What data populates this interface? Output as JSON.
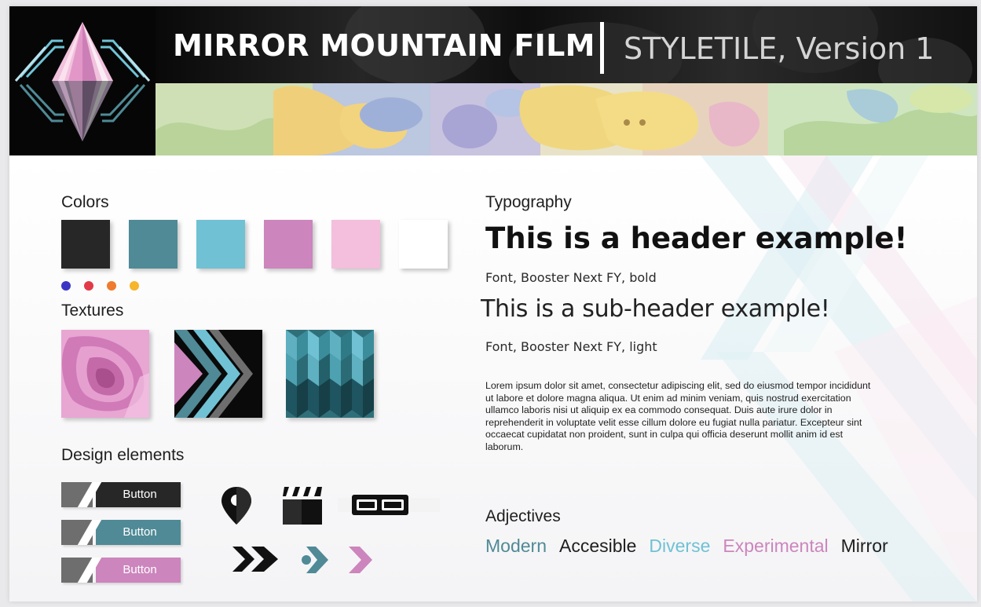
{
  "header": {
    "brand": "MIRROR MOUNTAIN FILM",
    "version": "STYLETILE, Version 1",
    "logo_icon": "mirror-mountain-logo-icon"
  },
  "colors": {
    "label": "Colors",
    "swatches": [
      "#272727",
      "#4f8a96",
      "#70c1d4",
      "#cc85bd",
      "#f3bfdc",
      "#ffffff"
    ],
    "dots": [
      "#3b37c4",
      "#e23a48",
      "#f07a2e",
      "#f6b52a"
    ]
  },
  "textures": {
    "label": "Textures",
    "items": [
      "pink-contour-texture",
      "black-chevron-texture",
      "teal-geometric-texture"
    ]
  },
  "design_elements": {
    "label": "Design elements",
    "buttons": [
      {
        "label": "Button",
        "bg": "#272727",
        "color": "#ffffff"
      },
      {
        "label": "Button",
        "bg": "#4f8a96",
        "color": "#ffffff"
      },
      {
        "label": "Button",
        "bg": "#cc85bd",
        "color": "#ffffff"
      }
    ],
    "icons": [
      "location-pin-icon",
      "clapperboard-icon",
      "film-strip-icon",
      "double-chevron-icon",
      "teal-chevron-icon",
      "pink-chevron-icon"
    ]
  },
  "typography": {
    "label": "Typography",
    "header_example": "This is a header example!",
    "header_font": "Font, Booster Next FY, bold",
    "subheader_example": "This is a sub-header example!",
    "subheader_font": "Font, Booster Next FY, light",
    "body_text": "Lorem ipsum dolor sit amet, consectetur adipiscing elit, sed do eiusmod tempor incididunt ut labore et dolore magna aliqua. Ut enim ad minim veniam, quis nostrud exercitation ullamco laboris nisi ut aliquip ex ea commodo consequat. Duis aute irure dolor in reprehenderit in voluptate velit esse cillum dolore eu fugiat nulla pariatur. Excepteur sint occaecat cupidatat non proident, sunt in culpa qui officia deserunt mollit anim id est laborum."
  },
  "adjectives": {
    "label": "Adjectives",
    "words": [
      {
        "text": "Modern",
        "color": "#4f8a96"
      },
      {
        "text": "Accesible",
        "color": "#1e1e1e"
      },
      {
        "text": "Diverse",
        "color": "#70c1d4"
      },
      {
        "text": "Experimental",
        "color": "#cc85bd"
      },
      {
        "text": "Mirror",
        "color": "#1e1e1e"
      }
    ]
  }
}
